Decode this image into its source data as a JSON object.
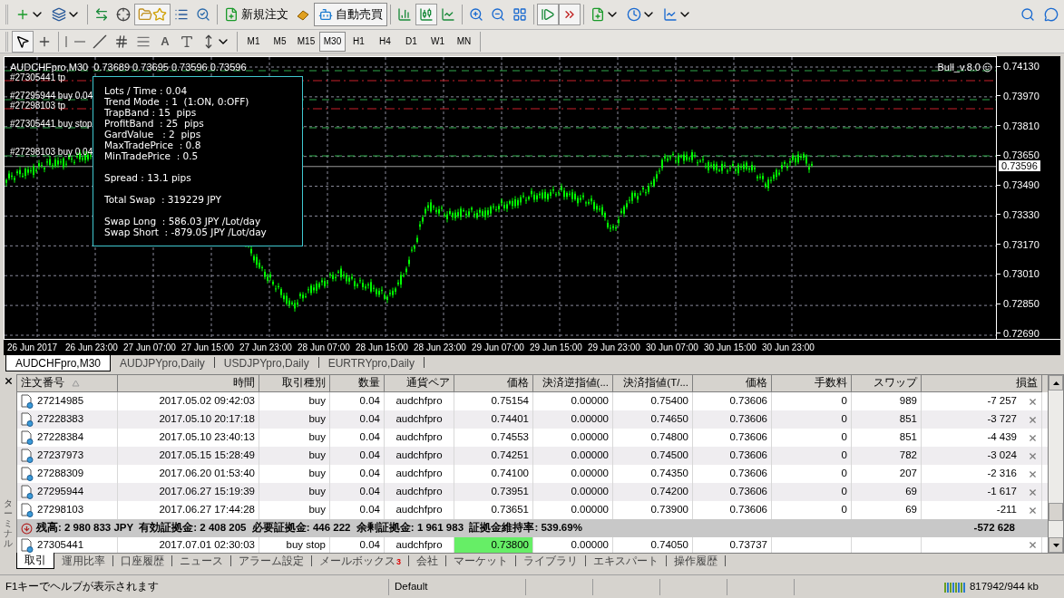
{
  "toolbar": {
    "navigator_pressed": true,
    "candles_pressed": true,
    "auto_scroll_pressed": true,
    "chart_shift_pressed": true,
    "new_order": "新規注文",
    "auto_trading": {
      "label": "自動売買",
      "pressed": true
    }
  },
  "drawing_tools": {
    "cursor_pressed": true,
    "text_tool": "A"
  },
  "timeframes": [
    {
      "label": "M1",
      "selected": false
    },
    {
      "label": "M5",
      "selected": false
    },
    {
      "label": "M15",
      "selected": false
    },
    {
      "label": "M30",
      "selected": true
    },
    {
      "label": "H1",
      "selected": false
    },
    {
      "label": "H4",
      "selected": false
    },
    {
      "label": "D1",
      "selected": false
    },
    {
      "label": "W1",
      "selected": false
    },
    {
      "label": "MN",
      "selected": false
    }
  ],
  "chart": {
    "header": "AUDCHFpro,M30  0.73689 0.73695 0.73596 0.73596",
    "indicator": "Bull_v.8.0",
    "order_labels": [
      "#27305441 tp",
      "#27295944 buy 0.04",
      "#27298103 tp",
      "#27305441 buy stop",
      "#27298103 buy 0.04"
    ],
    "info_groups": [
      [
        "Lots / Time : 0.04",
        "Trend Mode  : 1  (1:ON, 0:OFF)",
        "TrapBand : 15  pips",
        "ProfitBand  : 25  pips",
        "GardValue   : 2  pips",
        "MaxTradePrice  : 0.8",
        "MinTradePrice  : 0.5"
      ],
      [
        "Spread : 13.1 pips"
      ],
      [
        "Total Swap  : 319229 JPY"
      ],
      [
        "Swap Long  : 586.03 JPY /Lot/day",
        "Swap Short  : -879.05 JPY /Lot/day"
      ]
    ],
    "price_axis": [
      "0.74130",
      "0.73970",
      "0.73810",
      "0.73650",
      "0.73490",
      "0.73330",
      "0.73170",
      "0.73010",
      "0.72850",
      "0.72690"
    ],
    "current_price": "0.73596",
    "time_axis": [
      "26 Jun 2017",
      "26 Jun 23:00",
      "27 Jun 07:00",
      "27 Jun 15:00",
      "27 Jun 23:00",
      "28 Jun 07:00",
      "28 Jun 15:00",
      "28 Jun 23:00",
      "29 Jun 07:00",
      "29 Jun 15:00",
      "29 Jun 23:00",
      "30 Jun 07:00",
      "30 Jun 15:00",
      "30 Jun 23:00"
    ]
  },
  "chart_tabs": [
    {
      "label": "AUDCHFpro,M30",
      "selected": true
    },
    {
      "label": "AUDJPYpro,Daily",
      "selected": false
    },
    {
      "label": "USDJPYpro,Daily",
      "selected": false
    },
    {
      "label": "EURTRYpro,Daily",
      "selected": false
    }
  ],
  "terminal": {
    "side_label": "ターミナル",
    "columns": [
      {
        "label": "注文番号",
        "sorted": true
      },
      {
        "label": "時間",
        "sorted": false
      },
      {
        "label": "取引種別",
        "sorted": false
      },
      {
        "label": "数量",
        "sorted": false
      },
      {
        "label": "通貨ペア",
        "sorted": false
      },
      {
        "label": "価格",
        "sorted": false
      },
      {
        "label": "決済逆指値(...",
        "sorted": false
      },
      {
        "label": "決済指値(T/...",
        "sorted": false
      },
      {
        "label": "価格",
        "sorted": false
      },
      {
        "label": "手数料",
        "sorted": false
      },
      {
        "label": "スワップ",
        "sorted": false
      },
      {
        "label": "損益",
        "sorted": false
      }
    ],
    "rows": [
      {
        "kind": "open",
        "cells": [
          "27214985",
          "2017.05.02 09:42:03",
          "buy",
          "0.04",
          "audchfpro",
          "0.75154",
          "0.00000",
          "0.75400",
          "0.73606",
          "0",
          "989",
          "-7 257"
        ]
      },
      {
        "kind": "open",
        "cells": [
          "27228383",
          "2017.05.10 20:17:18",
          "buy",
          "0.04",
          "audchfpro",
          "0.74401",
          "0.00000",
          "0.74650",
          "0.73606",
          "0",
          "851",
          "-3 727"
        ]
      },
      {
        "kind": "open",
        "cells": [
          "27228384",
          "2017.05.10 23:40:13",
          "buy",
          "0.04",
          "audchfpro",
          "0.74553",
          "0.00000",
          "0.74800",
          "0.73606",
          "0",
          "851",
          "-4 439"
        ]
      },
      {
        "kind": "open",
        "cells": [
          "27237973",
          "2017.05.15 15:28:49",
          "buy",
          "0.04",
          "audchfpro",
          "0.74251",
          "0.00000",
          "0.74500",
          "0.73606",
          "0",
          "782",
          "-3 024"
        ]
      },
      {
        "kind": "open",
        "cells": [
          "27288309",
          "2017.06.20 01:53:40",
          "buy",
          "0.04",
          "audchfpro",
          "0.74100",
          "0.00000",
          "0.74350",
          "0.73606",
          "0",
          "207",
          "-2 316"
        ]
      },
      {
        "kind": "open",
        "cells": [
          "27295944",
          "2017.06.27 15:19:39",
          "buy",
          "0.04",
          "audchfpro",
          "0.73951",
          "0.00000",
          "0.74200",
          "0.73606",
          "0",
          "69",
          "-1 617"
        ]
      },
      {
        "kind": "open",
        "cells": [
          "27298103",
          "2017.06.27 17:44:28",
          "buy",
          "0.04",
          "audchfpro",
          "0.73651",
          "0.00000",
          "0.73900",
          "0.73606",
          "0",
          "69",
          "-211"
        ]
      },
      {
        "kind": "summary",
        "text": "残高: 2 980 833 JPY  有効証拠金: 2 408 205  必要証拠金: 446 222  余剰証拠金: 1 961 983  証拠金維持率: 539.69%",
        "total": "-572 628"
      },
      {
        "kind": "pending",
        "cells": [
          "27305441",
          "2017.07.01 02:30:03",
          "buy stop",
          "0.04",
          "audchfpro",
          "0.73800",
          "0.00000",
          "0.74050",
          "0.73737"
        ]
      }
    ]
  },
  "terminal_tabs": [
    {
      "label": "取引",
      "selected": true
    },
    {
      "label": "運用比率",
      "selected": false
    },
    {
      "label": "口座履歴",
      "selected": false
    },
    {
      "label": "ニュース",
      "selected": false
    },
    {
      "label": "アラーム設定",
      "selected": false
    },
    {
      "label": "メールボックス",
      "selected": false,
      "badge": "3"
    },
    {
      "label": "会社",
      "selected": false
    },
    {
      "label": "マーケット",
      "selected": false
    },
    {
      "label": "ライブラリ",
      "selected": false
    },
    {
      "label": "エキスパート",
      "selected": false
    },
    {
      "label": "操作履歴",
      "selected": false
    }
  ],
  "status_bar": {
    "help": "F1キーでヘルプが表示されます",
    "profile": "Default",
    "traffic": "817942/944 kb"
  }
}
